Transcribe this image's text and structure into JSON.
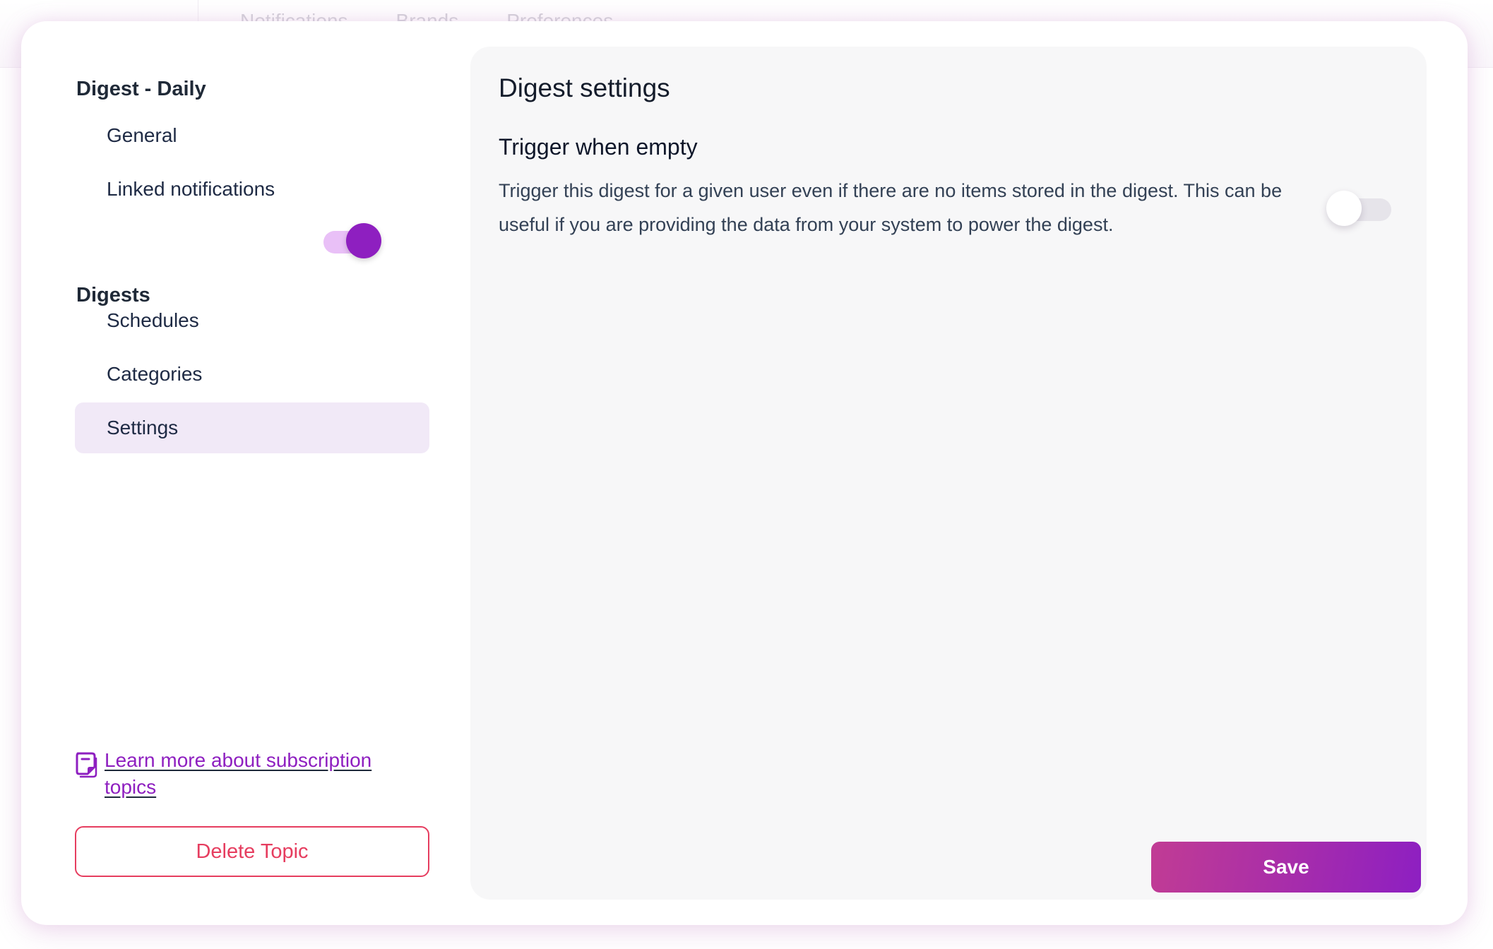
{
  "background": {
    "tabs": [
      "Notifications",
      "Brands",
      "Preferences"
    ]
  },
  "modal": {
    "left_nav": {
      "topic_title": "Digest - Daily",
      "topic_items": [
        {
          "label": "General",
          "active": false
        },
        {
          "label": "Linked notifications",
          "active": false
        }
      ],
      "digests_section": {
        "title": "Digests",
        "enabled": true
      },
      "digest_items": [
        {
          "label": "Schedules",
          "active": false
        },
        {
          "label": "Categories",
          "active": false
        },
        {
          "label": "Settings",
          "active": true
        }
      ],
      "learn_more_link": "Learn more about subscription topics",
      "learn_more_icon": "document-icon",
      "delete_button": "Delete Topic"
    },
    "panel": {
      "title": "Digest settings",
      "setting": {
        "title": "Trigger when empty",
        "description": "Trigger this digest for a given user even if there are no items stored in the digest. This can be useful if you are providing the data from your system to power the digest.",
        "enabled": false
      },
      "save_button": "Save"
    }
  },
  "colors": {
    "accent": "#8e1fc0",
    "accent_light": "#e9c0f7",
    "active_nav_bg": "#f1e9f7",
    "danger": "#e63d5f",
    "save_gradient_start": "#c13c94",
    "save_gradient_end": "#8d1fc2",
    "panel_bg": "#f7f7f8"
  }
}
